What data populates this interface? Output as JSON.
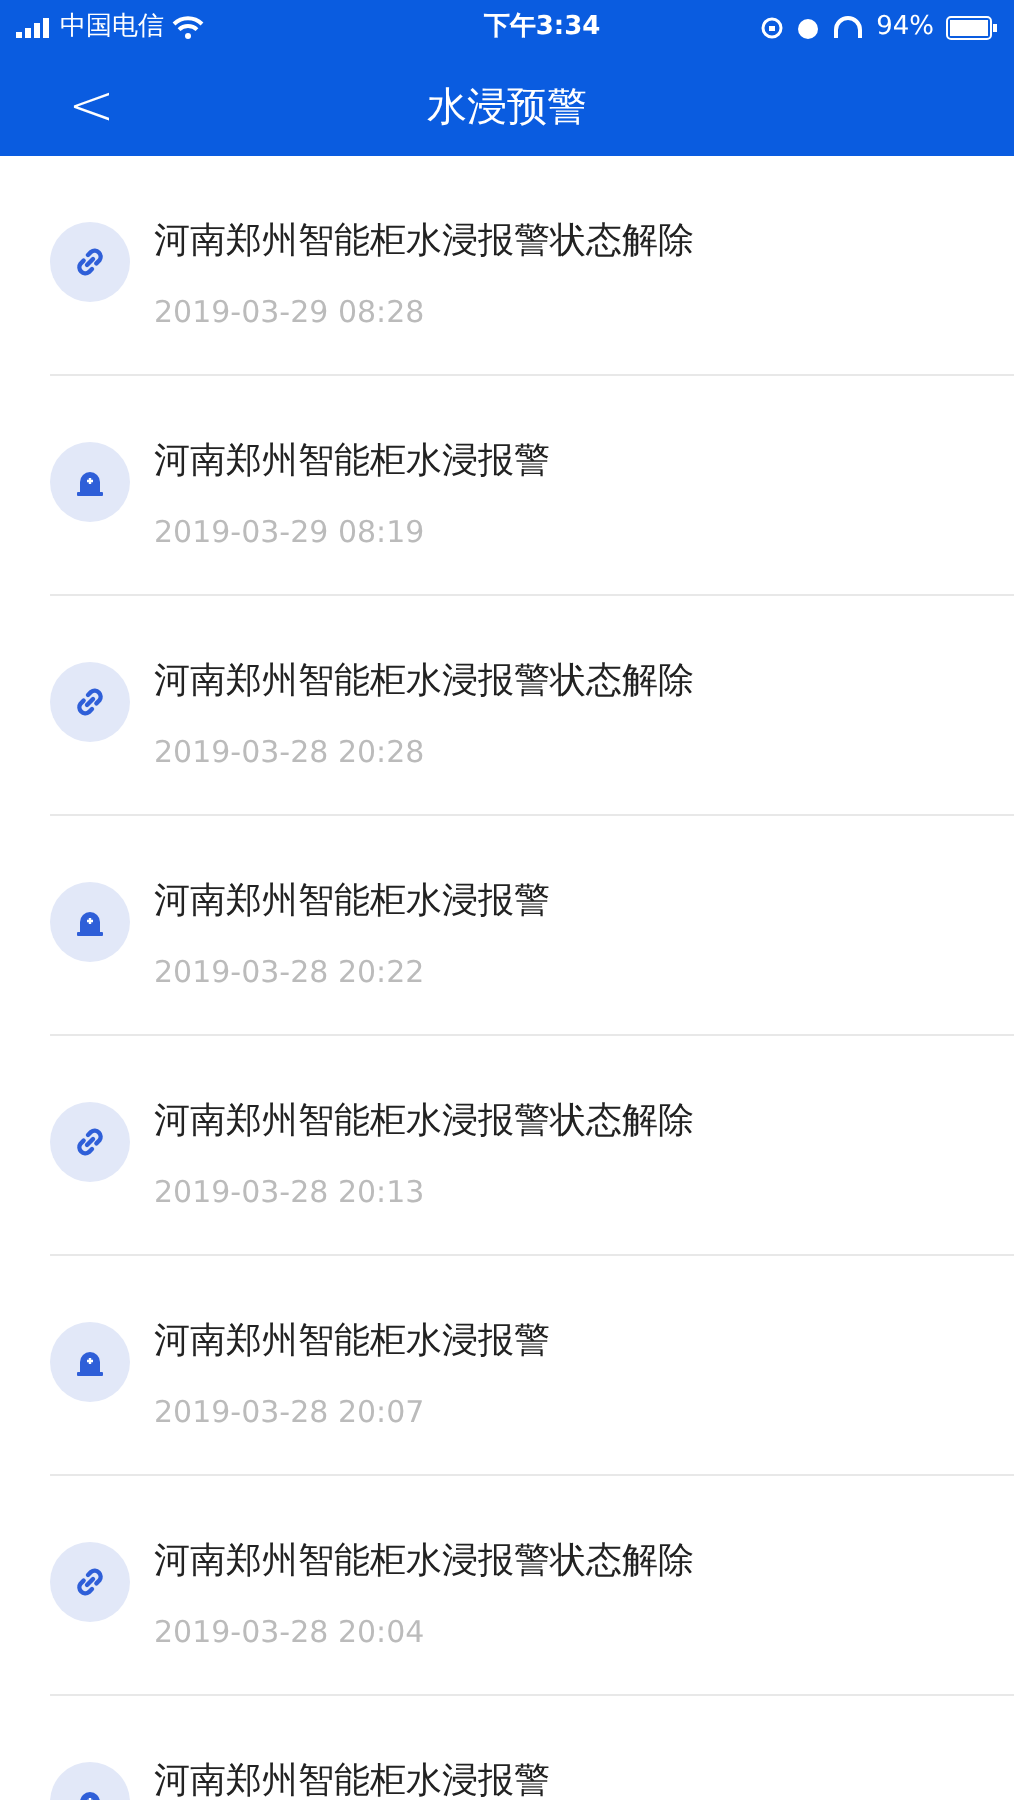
{
  "status_bar": {
    "carrier": "中国电信",
    "time": "下午3:34",
    "battery": "94%"
  },
  "nav": {
    "back": "<",
    "title": "水浸预警"
  },
  "items": [
    {
      "kind": "restored",
      "title": "河南郑州智能柜水浸报警状态解除",
      "time": "2019-03-29 08:28"
    },
    {
      "kind": "alarm",
      "title": "河南郑州智能柜水浸报警",
      "time": "2019-03-29 08:19"
    },
    {
      "kind": "restored",
      "title": "河南郑州智能柜水浸报警状态解除",
      "time": "2019-03-28 20:28"
    },
    {
      "kind": "alarm",
      "title": "河南郑州智能柜水浸报警",
      "time": "2019-03-28 20:22"
    },
    {
      "kind": "restored",
      "title": "河南郑州智能柜水浸报警状态解除",
      "time": "2019-03-28 20:13"
    },
    {
      "kind": "alarm",
      "title": "河南郑州智能柜水浸报警",
      "time": "2019-03-28 20:07"
    },
    {
      "kind": "restored",
      "title": "河南郑州智能柜水浸报警状态解除",
      "time": "2019-03-28 20:04"
    },
    {
      "kind": "alarm",
      "title": "河南郑州智能柜水浸报警"
    }
  ]
}
